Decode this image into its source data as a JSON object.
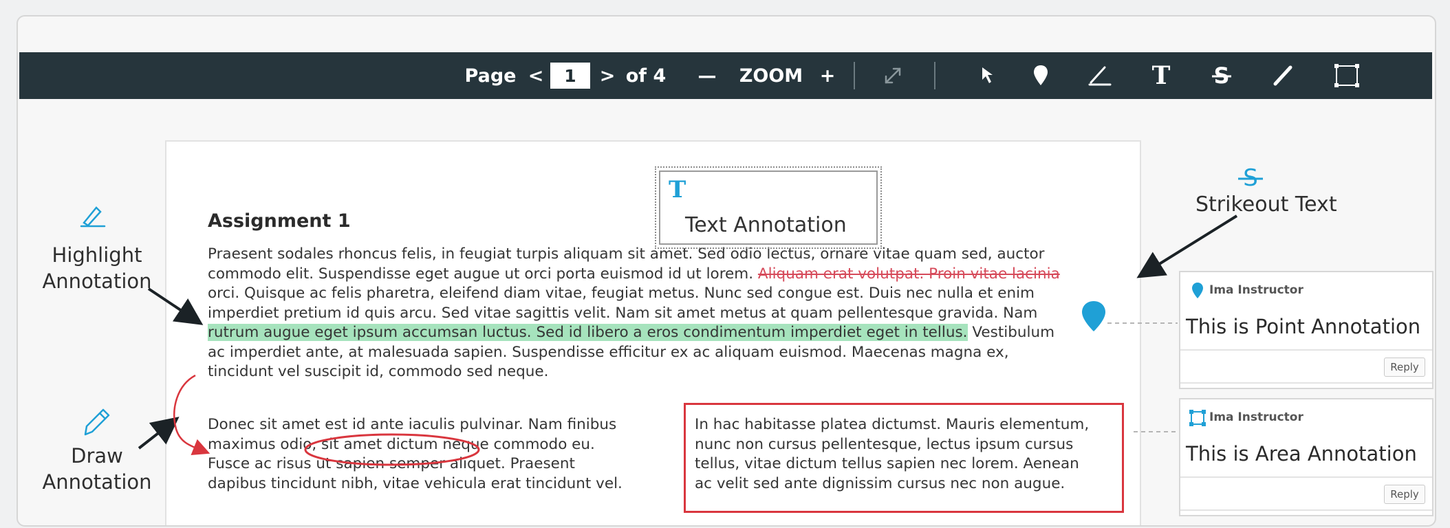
{
  "toolbar": {
    "page_label": "Page",
    "prev": "<",
    "page_value": "1",
    "next": ">",
    "of_label": "of 4",
    "zoom_out": "—",
    "zoom_label": "ZOOM",
    "zoom_in": "+",
    "tools": [
      "expand-icon",
      "pointer-icon",
      "point-pin-icon",
      "highlight-pen-icon",
      "text-tool-icon",
      "strikeout-icon",
      "draw-pencil-icon",
      "area-rect-icon"
    ]
  },
  "document": {
    "title": "Assignment 1",
    "para1": {
      "l1": "Praesent sodales rhoncus felis, in feugiat turpis aliquam sit amet. Sed odio lectus, ornare vitae quam sed, auctor",
      "l2_a": "commodo elit. Suspendisse eget augue ut orci porta euismod id ut lorem. ",
      "l2_strike": "Aliquam erat volutpat. Proin vitae lacinia",
      "l3": "orci. Quisque ac felis pharetra, eleifend diam vitae, feugiat metus. Nunc sed congue est. Duis nec nulla et enim",
      "l4": "imperdiet pretium id quis arcu. Sed vitae sagittis velit. Nam sit amet metus at quam pellentesque gravida. Nam",
      "l5_hl": "rutrum augue eget ipsum accumsan luctus. Sed id libero a eros condimentum imperdiet eget in tellus.",
      "l5_rest": " Vestibulum",
      "l6": "ac imperdiet ante, at malesuada sapien. Suspendisse efficitur ex ac aliquam euismod. Maecenas magna ex,",
      "l7": "tincidunt vel suscipit id, commodo sed neque."
    },
    "col_left": [
      "Donec sit amet est id ante iaculis pulvinar. Nam finibus",
      "maximus odio, sit amet dictum neque commodo eu.",
      "Fusce ac risus ut sapien semper aliquet. Praesent",
      "dapibus tincidunt nibh, vitae vehicula erat tincidunt vel."
    ],
    "col_right": [
      "In hac habitasse platea dictumst. Mauris elementum,",
      "nunc non cursus pellentesque, lectus ipsum cursus",
      "tellus, vitae dictum tellus sapien nec lorem. Aenean",
      "ac velit sed ante dignissim cursus nec non augue."
    ]
  },
  "callouts": {
    "text_annotation": "Text Annotation",
    "text_icon": "T",
    "highlight_l1": "Highlight",
    "highlight_l2": "Annotation",
    "draw_l1": "Draw",
    "draw_l2": "Annotation",
    "strikeout": "Strikeout Text"
  },
  "comments": [
    {
      "author": "Ima Instructor",
      "text": "This is Point Annotation",
      "reply": "Reply",
      "icon": "pin-icon"
    },
    {
      "author": "Ima Instructor",
      "text": "This is Area Annotation",
      "reply": "Reply",
      "icon": "area-icon"
    }
  ],
  "colors": {
    "toolbar": "#26353c",
    "highlight": "#a6e3bd",
    "strike": "#d64a5a",
    "area_box": "#d9363e",
    "accent_blue": "#1fa0d6"
  }
}
